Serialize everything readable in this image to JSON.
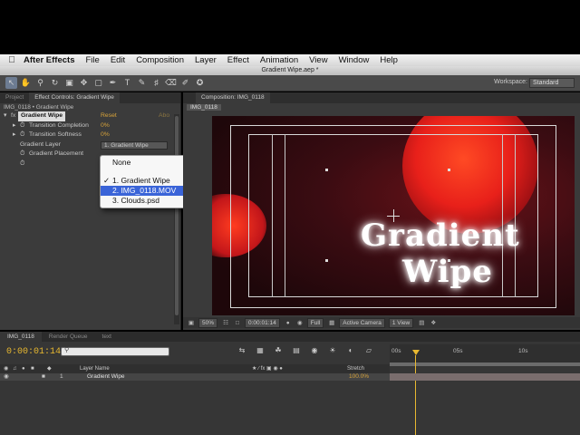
{
  "menu": {
    "app_name": "After Effects",
    "items": [
      "File",
      "Edit",
      "Composition",
      "Layer",
      "Effect",
      "Animation",
      "View",
      "Window",
      "Help"
    ]
  },
  "window": {
    "title": "Gradient Wipe.aep *"
  },
  "toolbar": {
    "workspace_label": "Workspace:",
    "workspace_value": "Standard"
  },
  "left_panel": {
    "tabs": [
      "Project",
      "Effect Controls: Gradient Wipe"
    ],
    "subtitle": "IMG_0118 • Gradient Wipe",
    "effect_name": "Gradient Wipe",
    "reset": "Reset",
    "about": "Abo",
    "properties": [
      {
        "label": "Transition Completion",
        "value": "0%"
      },
      {
        "label": "Transition Softness",
        "value": "0%"
      },
      {
        "label": "Gradient Layer",
        "value": "1. Gradient Wipe"
      },
      {
        "label": "Gradient Placement",
        "value": ""
      }
    ]
  },
  "dropdown": {
    "items": [
      "None",
      "1. Gradient Wipe",
      "2. IMG_0118.MOV",
      "3. Clouds.psd"
    ],
    "checked_index": 1,
    "highlighted_index": 2
  },
  "comp_panel": {
    "tab": "Composition: IMG_0118",
    "sub_label": "IMG_0118",
    "title_line1": "Gradient",
    "title_line2": "Wipe",
    "zoom": "50%",
    "timecode": "0:00:01:14",
    "resolution": "Full",
    "camera": "Active Camera",
    "views": "1 View"
  },
  "timeline": {
    "tabs": [
      "IMG_0118",
      "Render Queue",
      "text"
    ],
    "current_time": "0:00:01:14",
    "ruler_labels": [
      "00s",
      "05s",
      "10s"
    ],
    "column_layer_name": "Layer Name",
    "column_stretch": "Stretch",
    "layer": {
      "index": "1",
      "name": "Gradient Wipe",
      "stretch": "100.0%"
    }
  }
}
